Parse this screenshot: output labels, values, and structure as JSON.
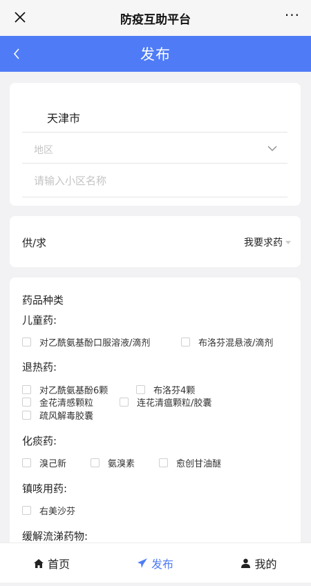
{
  "top": {
    "title": "防疫互助平台",
    "more": "···",
    "close_icon": "close-icon",
    "more_icon": "more-icon"
  },
  "header": {
    "title": "发布",
    "back_icon": "chevron-left-icon",
    "color": "#4f7cf6"
  },
  "location": {
    "city": "天津市",
    "region_placeholder": "地区",
    "community_placeholder": "请输入小区名称"
  },
  "supply": {
    "label": "供/求",
    "selected": "我要求药"
  },
  "medicine": {
    "title": "药品种类",
    "groups": [
      {
        "title": "儿童药:",
        "options": [
          "对乙酰氨基酚口服溶液/滴剂",
          "布洛芬混悬液/滴剂"
        ]
      },
      {
        "title": "退热药:",
        "options": [
          "对乙酰氨基酚6颗",
          "布洛芬4颗",
          "金花清感颗粒",
          "连花清瘟颗粒/胶囊",
          "疏风解毒胶囊"
        ]
      },
      {
        "title": "化痰药:",
        "options": [
          "溴己新",
          "氨溴素",
          "愈创甘油醚"
        ]
      },
      {
        "title": "镇咳用药:",
        "options": [
          "右美沙芬"
        ]
      },
      {
        "title": "缓解流涕药物:",
        "options": []
      }
    ]
  },
  "tabbar": {
    "home": "首页",
    "publish": "发布",
    "me": "我的",
    "active": "发布"
  }
}
